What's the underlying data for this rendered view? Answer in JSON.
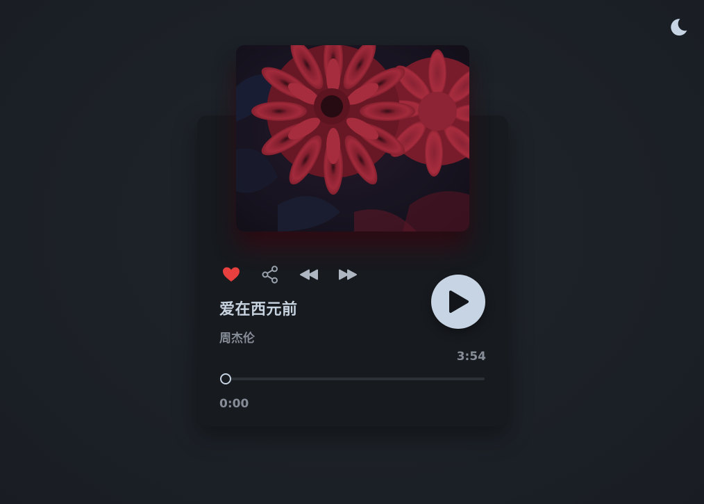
{
  "theme": {
    "toggle_icon": "moon-icon",
    "background": "#1c2127",
    "card_color": "#171a1f",
    "accent": "#c7d4e3",
    "like_color": "#e8403f"
  },
  "player": {
    "cover_art": "red-gerbera-flower-image",
    "controls": [
      {
        "name": "like",
        "icon": "heart-icon",
        "active": true
      },
      {
        "name": "share",
        "icon": "share-icon"
      },
      {
        "name": "previous",
        "icon": "rewind-icon"
      },
      {
        "name": "next",
        "icon": "fast-forward-icon"
      }
    ],
    "song_title": "爱在西元前",
    "artist": "周杰伦",
    "play_icon": "play-icon",
    "duration": "3:54",
    "elapsed": "0:00",
    "progress": 0
  }
}
